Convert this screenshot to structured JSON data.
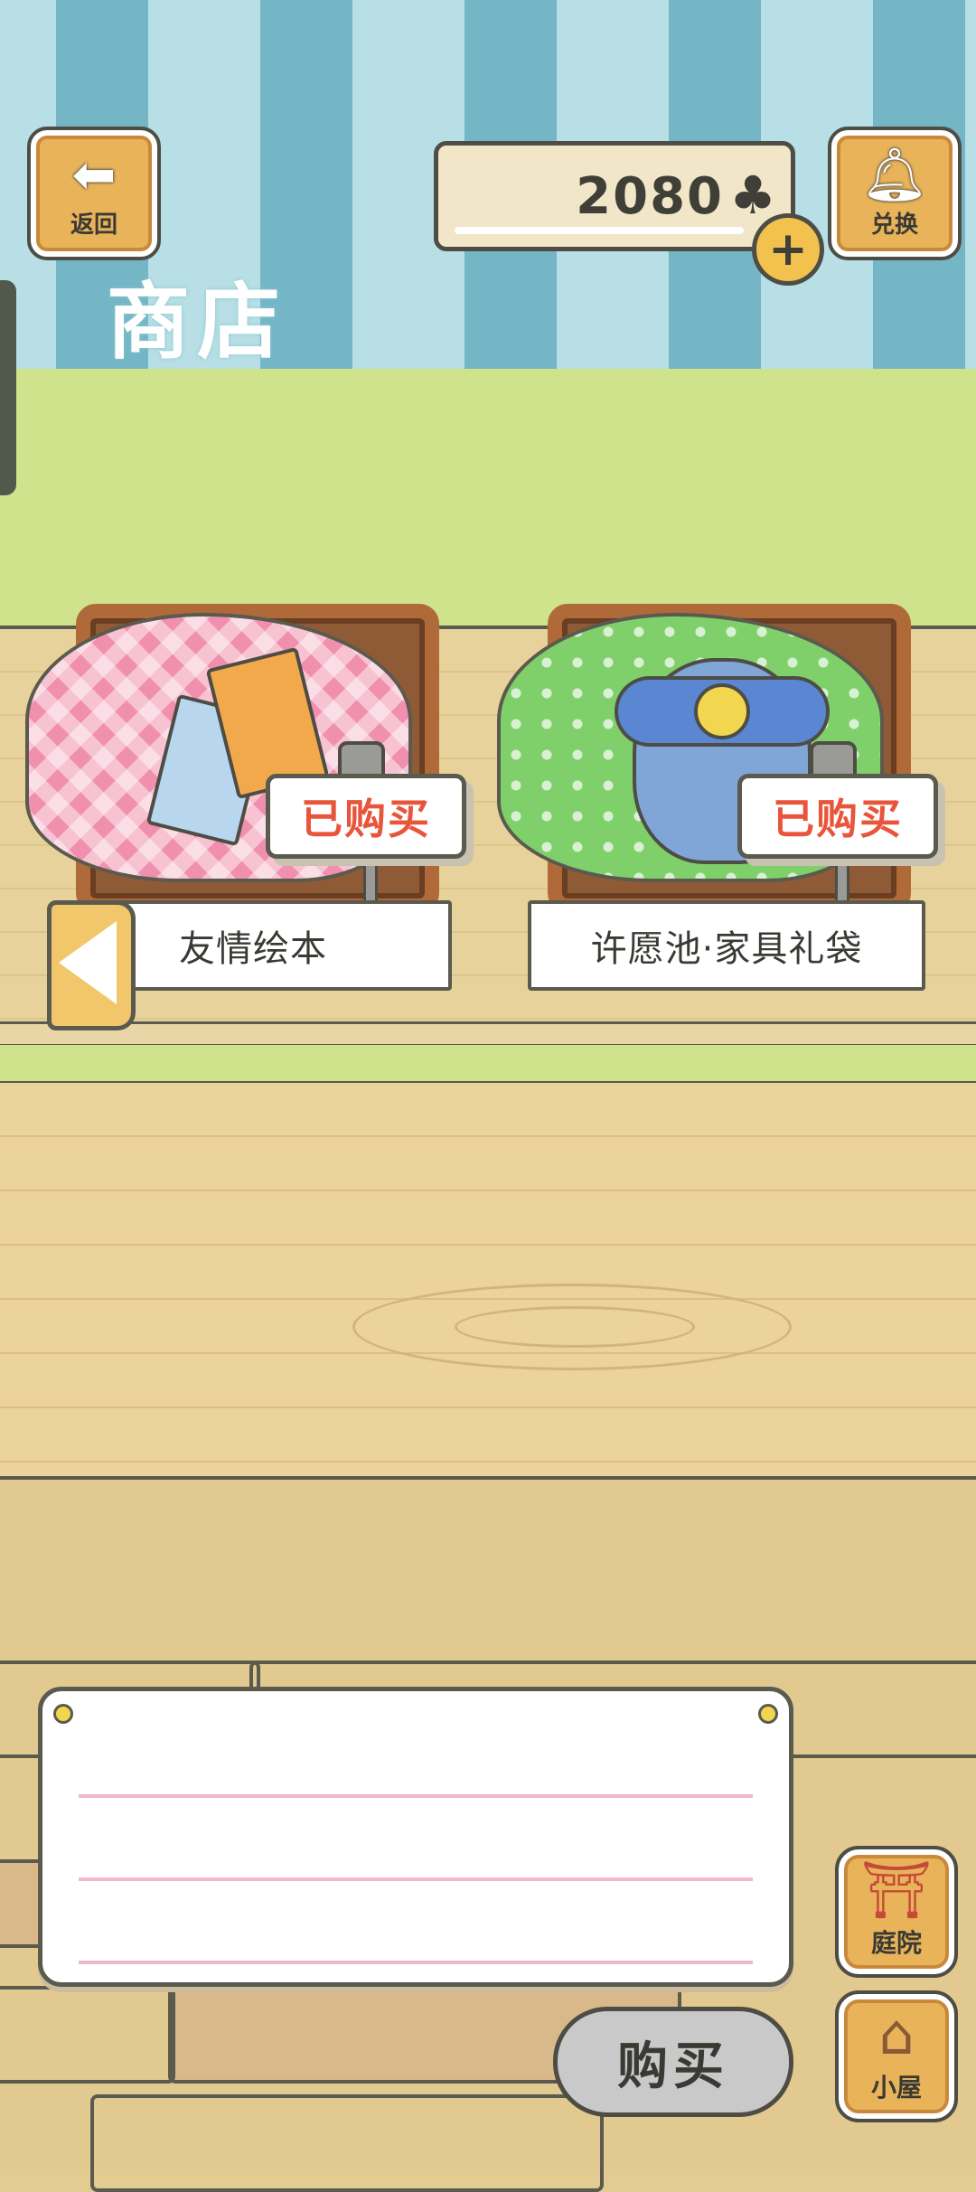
{
  "header": {
    "back_label": "返回",
    "title": "商店",
    "exchange_label": "兑换",
    "currency_amount": "2080",
    "currency_icon": "clover-icon"
  },
  "products": [
    {
      "name": "友情绘本",
      "status": "已购买",
      "cloth_color": "#f08fae"
    },
    {
      "name": "许愿池·家具礼袋",
      "status": "已购买",
      "cloth_color": "#7fcf6a"
    }
  ],
  "actions": {
    "buy_label": "购买"
  },
  "side_nav": {
    "yard_label": "庭院",
    "house_label": "小屋"
  }
}
